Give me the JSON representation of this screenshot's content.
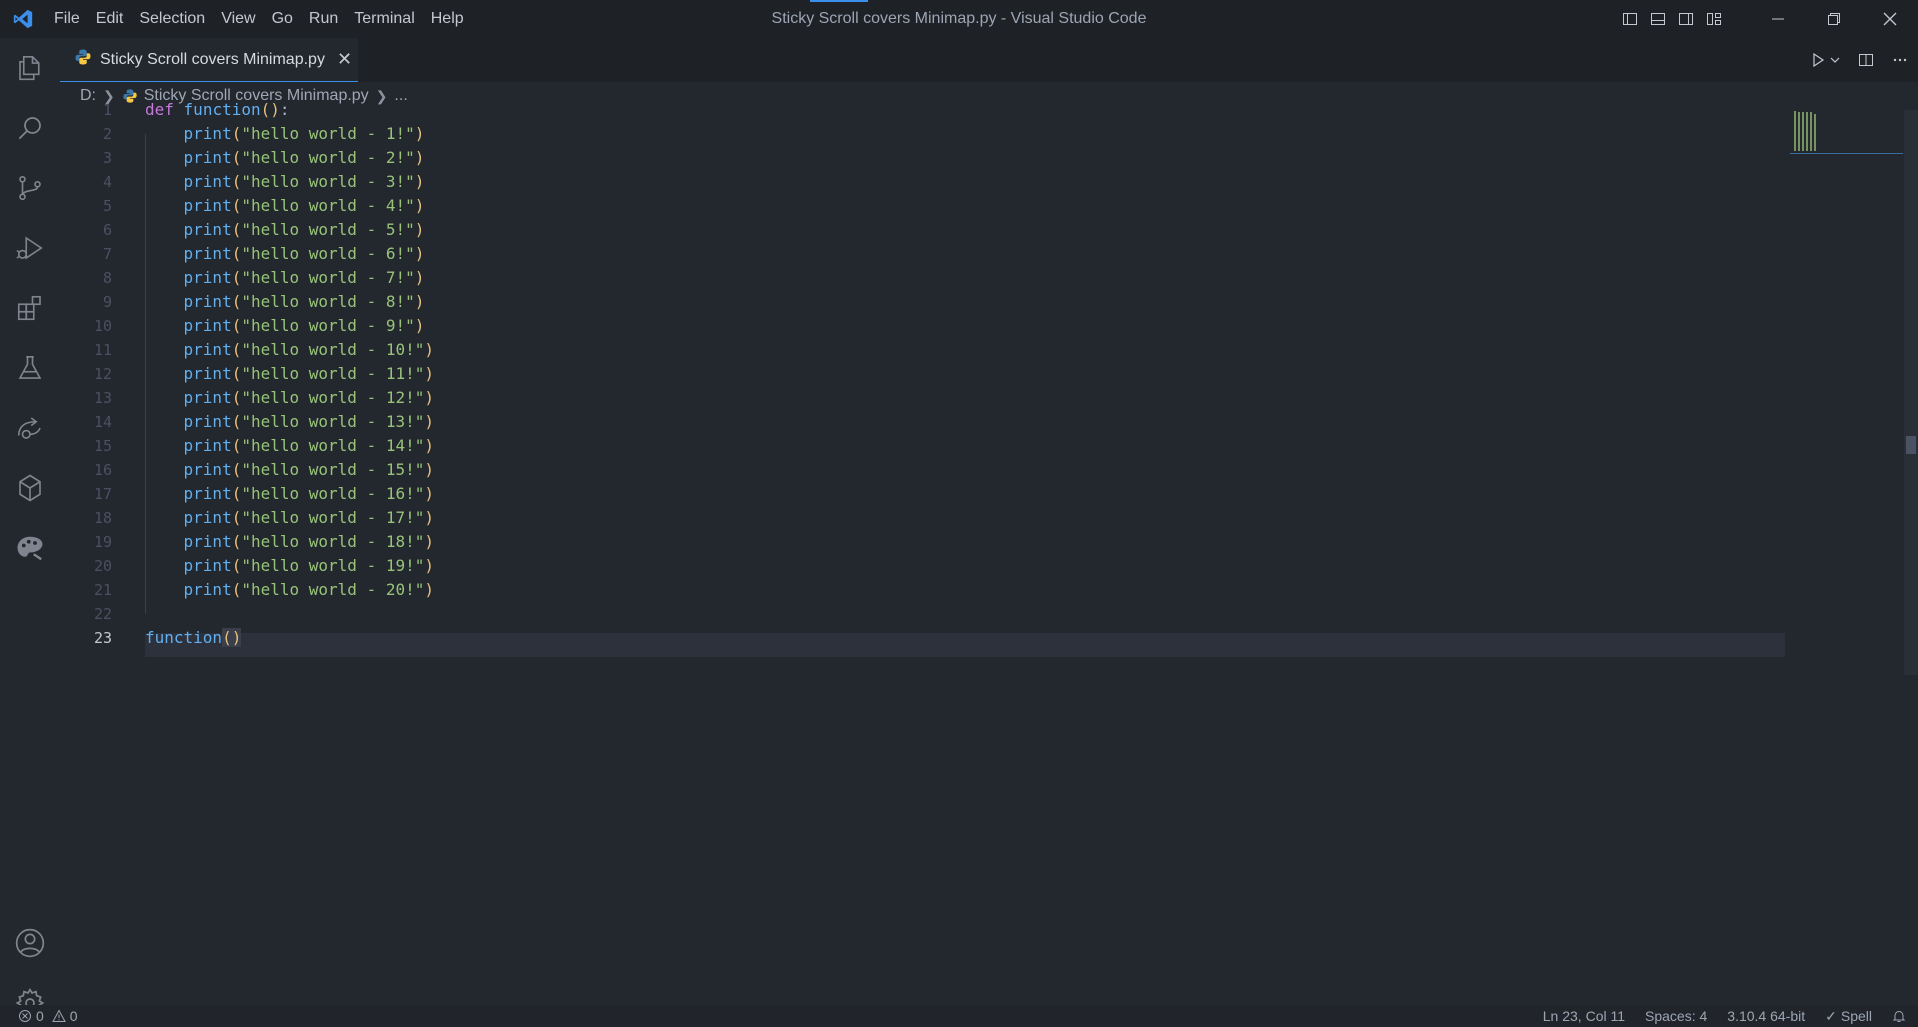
{
  "window": {
    "title": "Sticky Scroll covers Minimap.py - Visual Studio Code",
    "menu": [
      "File",
      "Edit",
      "Selection",
      "View",
      "Go",
      "Run",
      "Terminal",
      "Help"
    ]
  },
  "activity_bar": {
    "items": [
      "explorer-icon",
      "search-icon",
      "source-control-icon",
      "run-debug-icon",
      "extensions-icon",
      "testing-icon",
      "remote-explorer-icon",
      "docker-icon",
      "theme-icon"
    ],
    "bottom": [
      "account-icon",
      "settings-gear-icon"
    ]
  },
  "tab": {
    "label": "Sticky Scroll covers Minimap.py",
    "close": "✕"
  },
  "breadcrumb": {
    "drive": "D:",
    "file": "Sticky Scroll covers Minimap.py",
    "more": "..."
  },
  "editor": {
    "line_numbers": [
      "1",
      "2",
      "3",
      "4",
      "5",
      "6",
      "7",
      "8",
      "9",
      "10",
      "11",
      "12",
      "13",
      "14",
      "15",
      "16",
      "17",
      "18",
      "19",
      "20",
      "21",
      "22",
      "23"
    ],
    "line1": {
      "kw": "def",
      "fn": "function",
      "open": "(",
      "close": ")",
      "colon": ":"
    },
    "print_fn": "print",
    "strings": [
      "\"hello world - 1!\"",
      "\"hello world - 2!\"",
      "\"hello world - 3!\"",
      "\"hello world - 4!\"",
      "\"hello world - 5!\"",
      "\"hello world - 6!\"",
      "\"hello world - 7!\"",
      "\"hello world - 8!\"",
      "\"hello world - 9!\"",
      "\"hello world - 10!\"",
      "\"hello world - 11!\"",
      "\"hello world - 12!\"",
      "\"hello world - 13!\"",
      "\"hello world - 14!\"",
      "\"hello world - 15!\"",
      "\"hello world - 16!\"",
      "\"hello world - 17!\"",
      "\"hello world - 18!\"",
      "\"hello world - 19!\"",
      "\"hello world - 20!\""
    ],
    "line23": {
      "fn": "function",
      "parens": "()"
    },
    "active_line": "23"
  },
  "status_bar": {
    "errors": "0",
    "warnings": "0",
    "cursor": "Ln 23, Col 11",
    "spaces": "Spaces: 4",
    "python": "3.10.4 64-bit",
    "spell": "Spell"
  },
  "colors": {
    "accent": "#3b8eea",
    "keyword": "#c678dd",
    "function": "#61afef",
    "string": "#98c379",
    "paren": "#e5c07b"
  }
}
